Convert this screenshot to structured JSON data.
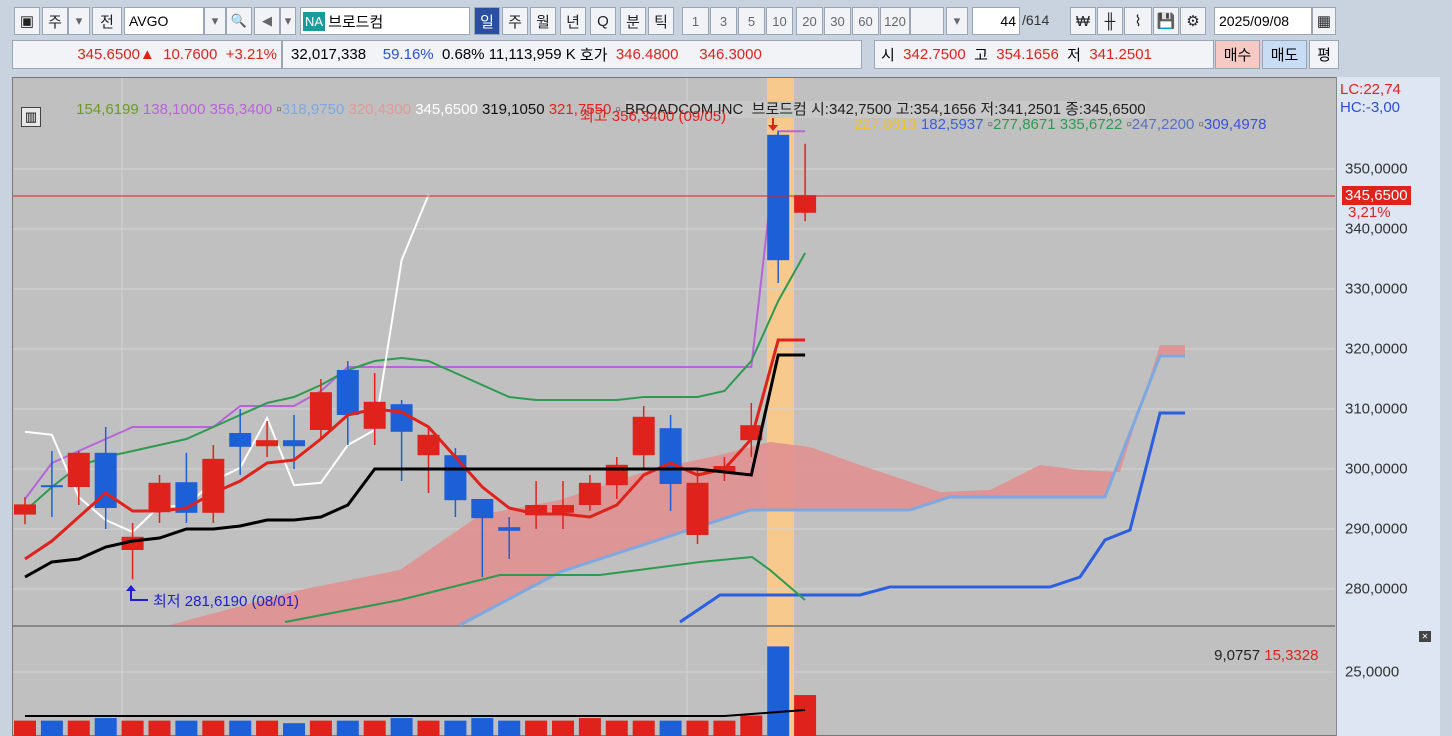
{
  "toolbar": {
    "market_label": "주",
    "prev_label": "전",
    "symbol": "AVGO",
    "exchange_badge": "NA",
    "stock_name": "브로드컴",
    "periods": [
      "일",
      "주",
      "월",
      "년",
      "Q",
      "분",
      "틱"
    ],
    "intervals": [
      "1",
      "3",
      "5",
      "10",
      "20",
      "30",
      "60",
      "120"
    ],
    "count_value": "44",
    "count_total": "/614",
    "date": "2025/09/08"
  },
  "quote": {
    "price": "345.6500",
    "change_arrow": "▲",
    "change": "10.7600",
    "change_pct": "+3.21%",
    "volume": "32,017,338",
    "vol_ratio": "59.16%",
    "turnover": "0.68%",
    "amount": "11,113,959 K",
    "hoga_label": "호가",
    "ask": "346.4800",
    "bid": "346.3000",
    "open_label": "시",
    "open": "342.7500",
    "high_label": "고",
    "high": "354.1656",
    "low_label": "저",
    "low": "341.2501",
    "buy_label": "매수",
    "sell_label": "매도",
    "avg_label": "평"
  },
  "legend": {
    "l1": "154,6199",
    "l2": "138,1000 356,3400",
    "l3": "318,9750",
    "l4": "320,4300",
    "l5": "345,6500",
    "l6": "319,1050",
    "l7": "321,7550",
    "info": "BROADCOM INC  브로드컴 시:342,7500 고:354,1656 저:341,2501 종:345,6500",
    "r1": "227,8613",
    "r2": "182,5937",
    "r3": "277,8671 335,6722",
    "r4": "247,2200",
    "r5": "309,4978",
    "lc": "LC:22,74",
    "hc": "HC:-3,00"
  },
  "annotations": {
    "high": "최고 356,3400 (09/05)",
    "low": "최저 281,6190 (08/01)"
  },
  "price_axis": [
    "350,0000",
    "340,0000",
    "330,0000",
    "320,0000",
    "310,0000",
    "300,0000",
    "290,0000",
    "280,0000"
  ],
  "current_price_tag": "345,6500",
  "current_pct_tag": "3,21%",
  "volume_panel": {
    "label1": "9,0757",
    "label2": "15,3328",
    "axis": "25,0000"
  },
  "colors": {
    "up": "#e0221c",
    "down": "#1d5fd6",
    "highlight": "#f7c98d"
  },
  "chart_data": {
    "type": "candlestick",
    "candles": [
      [
        292.4,
        294.1,
        295.3,
        290.8
      ],
      [
        297.3,
        297.0,
        303,
        292
      ],
      [
        297,
        302.7,
        303,
        294
      ],
      [
        302.7,
        293.5,
        307,
        290
      ],
      [
        286.5,
        288.7,
        291,
        281.6
      ],
      [
        292.8,
        297.7,
        299,
        291
      ],
      [
        297.8,
        292.7,
        302.7,
        291
      ],
      [
        292.7,
        301.7,
        304,
        291
      ],
      [
        306,
        303.7,
        310,
        299
      ],
      [
        303.8,
        304.8,
        308,
        302
      ],
      [
        304.8,
        303.8,
        309,
        300
      ],
      [
        306.5,
        312.8,
        315,
        305
      ],
      [
        316.5,
        309,
        318,
        304
      ],
      [
        306.7,
        311.2,
        316,
        304
      ],
      [
        310.8,
        306.2,
        311.5,
        298
      ],
      [
        302.3,
        305.7,
        307,
        296
      ],
      [
        302.3,
        294.8,
        303.5,
        292
      ],
      [
        295,
        291.8,
        293,
        282
      ],
      [
        290.3,
        289.7,
        292,
        285
      ],
      [
        292.3,
        294,
        298,
        290
      ],
      [
        292.7,
        294,
        298,
        290
      ],
      [
        294,
        297.7,
        299,
        293
      ],
      [
        297.3,
        300.7,
        302,
        295
      ],
      [
        302.3,
        308.7,
        310.5,
        300
      ],
      [
        306.8,
        297.5,
        309,
        293
      ],
      [
        289,
        297.7,
        300,
        287.5
      ],
      [
        299.5,
        300.5,
        302,
        298
      ],
      [
        304.8,
        307.3,
        311,
        302
      ],
      [
        355.7,
        334.8,
        356.3,
        331
      ],
      [
        342.7,
        345.65,
        354.2,
        341.3
      ]
    ],
    "volume": [
      6,
      6,
      6,
      7,
      6,
      6,
      6,
      6,
      6,
      6,
      5,
      6,
      6,
      6,
      7,
      6,
      6,
      7,
      6,
      6,
      6,
      7,
      6,
      6,
      6,
      6,
      6,
      8,
      35,
      16
    ],
    "ma_red": [
      285,
      288,
      292,
      296,
      293,
      293,
      293.5,
      296,
      298,
      301,
      301.5,
      305,
      309,
      310,
      309.5,
      307,
      302,
      297,
      293.5,
      292.5,
      292.5,
      292,
      294,
      299,
      301,
      299,
      300,
      305,
      321.5,
      321.5
    ],
    "ma_black": [
      282,
      284.5,
      285,
      287,
      288,
      288.5,
      290,
      290,
      290.5,
      291.5,
      291.5,
      292,
      294,
      300,
      300,
      300,
      300,
      300,
      300,
      300,
      300,
      300,
      300,
      300,
      300,
      300,
      299.5,
      299,
      319,
      319
    ],
    "ma_green": [
      293,
      297,
      300.5,
      302,
      303,
      304,
      305,
      307,
      309,
      311,
      312,
      314,
      316.5,
      318,
      318.5,
      318,
      316,
      314,
      312,
      311.5,
      311.5,
      311.5,
      311.5,
      312,
      312,
      312,
      313,
      318,
      328,
      336
    ],
    "ma_purple": [
      295,
      301,
      303,
      305,
      307,
      307,
      307,
      307,
      310.5,
      310.5,
      310.5,
      313,
      317,
      317,
      317,
      317,
      317,
      317,
      317,
      317,
      317,
      317,
      317,
      317,
      317,
      317,
      317,
      317,
      356.3,
      356.3
    ],
    "ma_white": [
      306.2,
      305.7,
      295.3,
      291.5,
      289.5,
      293.8,
      293.8,
      298,
      300.2,
      308.5,
      297.3,
      297.7,
      304,
      306.5,
      334.8,
      345.7
    ],
    "ylim": [
      276,
      361
    ]
  }
}
